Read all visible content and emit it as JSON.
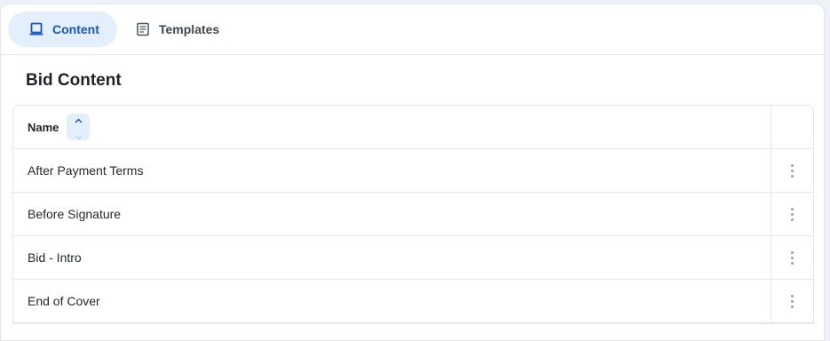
{
  "tabs": [
    {
      "label": "Content",
      "icon": "laptop-icon",
      "active": true
    },
    {
      "label": "Templates",
      "icon": "document-icon",
      "active": false
    }
  ],
  "section": {
    "title": "Bid Content"
  },
  "table": {
    "columns": [
      {
        "label": "Name",
        "sort": "ascending"
      },
      {
        "label": ""
      }
    ],
    "rows": [
      {
        "name": "After Payment Terms"
      },
      {
        "name": "Before Signature"
      },
      {
        "name": "Bid - Intro"
      },
      {
        "name": "End of Cover"
      }
    ]
  },
  "colors": {
    "accent": "#1a56b8",
    "active_tab_bg": "#e3effd",
    "border": "#e3e6ea",
    "background": "#eef1f5"
  }
}
